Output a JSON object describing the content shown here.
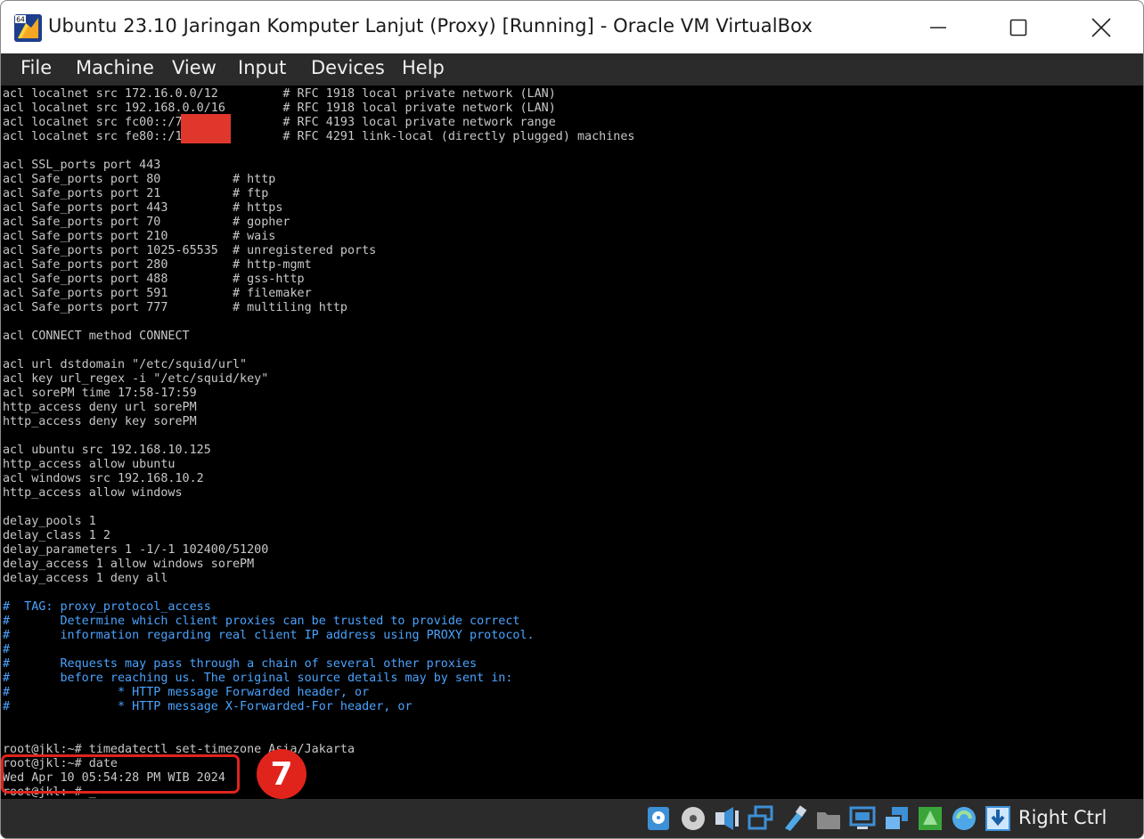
{
  "window": {
    "title": "Ubuntu 23.10 Jaringan Komputer Lanjut (Proxy) [Running] - Oracle VM VirtualBox",
    "app_icon_badge": "64"
  },
  "menu": [
    "File",
    "Machine",
    "View",
    "Input",
    "Devices",
    "Help"
  ],
  "terminal": {
    "lines": [
      {
        "text": "acl localnet src 172.16.0.0/12         # RFC 1918 local private network (LAN)",
        "kind": "normal"
      },
      {
        "text": "acl localnet src 192.168.0.0/16        # RFC 1918 local private network (LAN)",
        "kind": "normal"
      },
      {
        "text": "acl localnet src fc00::/7              # RFC 4193 local private network range",
        "kind": "normal"
      },
      {
        "text": "acl localnet src fe80::/10             # RFC 4291 link-local (directly plugged) machines",
        "kind": "normal"
      },
      {
        "text": "",
        "kind": "normal"
      },
      {
        "text": "acl SSL_ports port 443",
        "kind": "normal"
      },
      {
        "text": "acl Safe_ports port 80          # http",
        "kind": "normal"
      },
      {
        "text": "acl Safe_ports port 21          # ftp",
        "kind": "normal"
      },
      {
        "text": "acl Safe_ports port 443         # https",
        "kind": "normal"
      },
      {
        "text": "acl Safe_ports port 70          # gopher",
        "kind": "normal"
      },
      {
        "text": "acl Safe_ports port 210         # wais",
        "kind": "normal"
      },
      {
        "text": "acl Safe_ports port 1025-65535  # unregistered ports",
        "kind": "normal"
      },
      {
        "text": "acl Safe_ports port 280         # http-mgmt",
        "kind": "normal"
      },
      {
        "text": "acl Safe_ports port 488         # gss-http",
        "kind": "normal"
      },
      {
        "text": "acl Safe_ports port 591         # filemaker",
        "kind": "normal"
      },
      {
        "text": "acl Safe_ports port 777         # multiling http",
        "kind": "normal"
      },
      {
        "text": "",
        "kind": "normal"
      },
      {
        "text": "acl CONNECT method CONNECT",
        "kind": "normal"
      },
      {
        "text": "",
        "kind": "normal"
      },
      {
        "text": "acl url dstdomain \"/etc/squid/url\"",
        "kind": "normal"
      },
      {
        "text": "acl key url_regex -i \"/etc/squid/key\"",
        "kind": "normal"
      },
      {
        "text": "acl sorePM time 17:58-17:59",
        "kind": "normal"
      },
      {
        "text": "http_access deny url sorePM",
        "kind": "normal"
      },
      {
        "text": "http_access deny key sorePM",
        "kind": "normal"
      },
      {
        "text": "",
        "kind": "normal"
      },
      {
        "text": "acl ubuntu src 192.168.10.125",
        "kind": "normal"
      },
      {
        "text": "http_access allow ubuntu",
        "kind": "normal"
      },
      {
        "text": "acl windows src 192.168.10.2",
        "kind": "normal"
      },
      {
        "text": "http_access allow windows",
        "kind": "normal"
      },
      {
        "text": "",
        "kind": "normal"
      },
      {
        "text": "delay_pools 1",
        "kind": "normal"
      },
      {
        "text": "delay_class 1 2",
        "kind": "normal"
      },
      {
        "text": "delay_parameters 1 -1/-1 102400/51200",
        "kind": "normal"
      },
      {
        "text": "delay_access 1 allow windows sorePM",
        "kind": "normal"
      },
      {
        "text": "delay_access 1 deny all",
        "kind": "normal"
      },
      {
        "text": "",
        "kind": "normal"
      },
      {
        "text": "#  TAG: proxy_protocol_access",
        "kind": "comment"
      },
      {
        "text": "#       Determine which client proxies can be trusted to provide correct",
        "kind": "comment"
      },
      {
        "text": "#       information regarding real client IP address using PROXY protocol.",
        "kind": "comment"
      },
      {
        "text": "#",
        "kind": "comment"
      },
      {
        "text": "#       Requests may pass through a chain of several other proxies",
        "kind": "comment"
      },
      {
        "text": "#       before reaching us. The original source details may by sent in:",
        "kind": "comment"
      },
      {
        "text": "#               * HTTP message Forwarded header, or",
        "kind": "comment"
      },
      {
        "text": "#               * HTTP message X-Forwarded-For header, or",
        "kind": "comment"
      },
      {
        "text": "",
        "kind": "normal"
      },
      {
        "text": "",
        "kind": "normal"
      },
      {
        "text": "root@jkl:~# timedatectl set-timezone Asia/Jakarta",
        "kind": "normal"
      },
      {
        "text": "root@jkl:~# date",
        "kind": "normal"
      },
      {
        "text": "Wed Apr 10 05:54:28 PM WIB 2024",
        "kind": "normal"
      },
      {
        "text": "root@jkl:~# _",
        "kind": "normal"
      }
    ]
  },
  "annotation": {
    "step_number": "7",
    "color": "#e0241b"
  },
  "status_icons": [
    "hard-disk-icon",
    "optical-drive-icon",
    "audio-icon",
    "network-icon",
    "usb-icon",
    "shared-folders-icon",
    "display-icon",
    "capture-icon",
    "recording-icon",
    "cpu-activity-icon",
    "mouse-integration-icon",
    "keyboard-capture-icon"
  ],
  "status": {
    "host_key": "Right Ctrl"
  },
  "colors": {
    "terminal_text": "#c8c8c8",
    "comment_text": "#4aa3ff",
    "bar_bg": "#2b2b2b"
  }
}
